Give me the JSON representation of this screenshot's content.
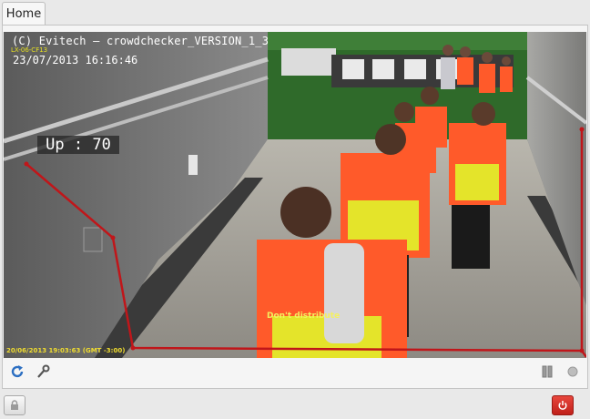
{
  "tabs": [
    {
      "label": "Home"
    }
  ],
  "video": {
    "title": "(C) Evitech — crowdchecker_VERSION_1_3",
    "camera_id": "LX-06-CF13",
    "datetime": "23/07/2013   16:16:46",
    "counter": "Up : 70",
    "shirt_text": "Don't distribute",
    "source_timestamp": "20/06/2013 19:03:63 (GMT -3:00)",
    "zone_color": "#c0161a"
  },
  "controls": {
    "refresh_icon": "refresh-icon",
    "settings_icon": "wrench-icon",
    "pause_icon": "pause-icon",
    "status_icon": "status-dot-icon"
  },
  "footer": {
    "lock_icon": "lock-icon",
    "power_icon": "power-icon",
    "power_color": "#d0261e"
  }
}
